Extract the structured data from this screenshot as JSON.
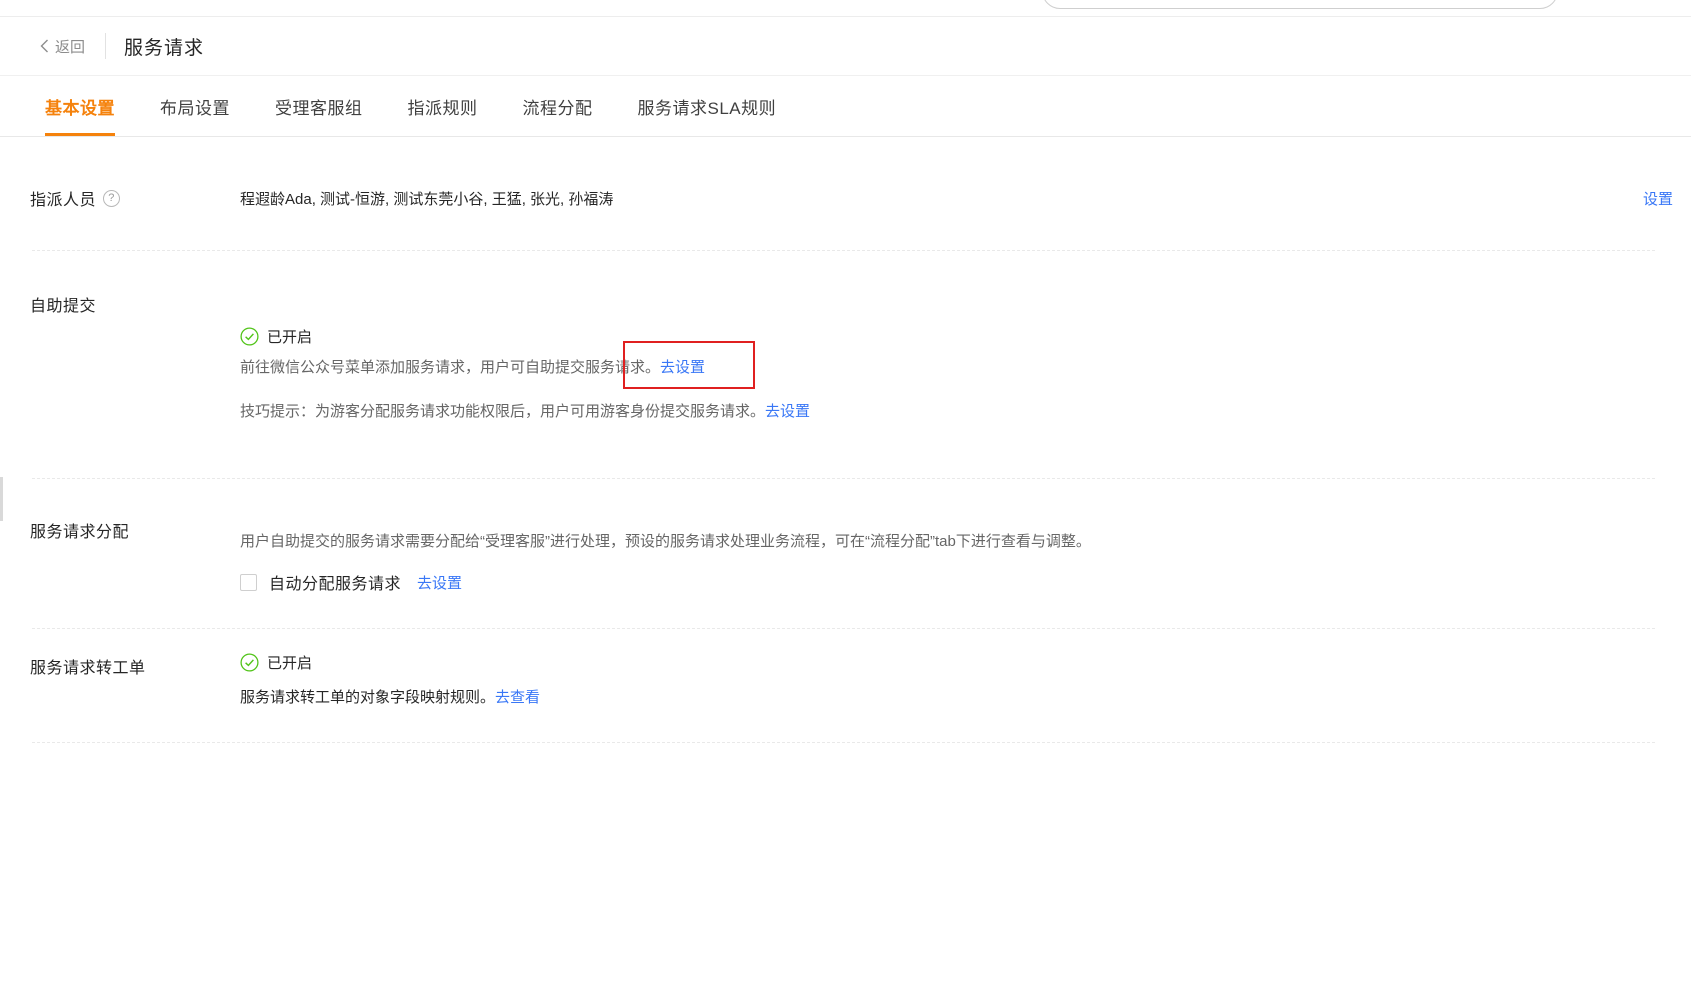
{
  "colors": {
    "accent_orange": "#f5820c",
    "link_blue": "#3977f6",
    "success_green": "#52c41a",
    "annotation_red": "#e02020"
  },
  "icons": {
    "back": "chevron-left-icon",
    "help_glyph": "?",
    "status_enabled": "check-circle-icon"
  },
  "header": {
    "back_label": "返回",
    "title": "服务请求"
  },
  "tabs": [
    {
      "label": "基本设置",
      "active": true
    },
    {
      "label": "布局设置",
      "active": false
    },
    {
      "label": "受理客服组",
      "active": false
    },
    {
      "label": "指派规则",
      "active": false
    },
    {
      "label": "流程分配",
      "active": false
    },
    {
      "label": "服务请求SLA规则",
      "active": false
    }
  ],
  "sections": {
    "assignee": {
      "label": "指派人员",
      "value": "程遐龄Ada, 测试-恒游, 测试东莞小谷, 王猛, 张光, 孙福涛",
      "action": "设置"
    },
    "self_service": {
      "label": "自助提交",
      "status": "已开启",
      "desc": "前往微信公众号菜单添加服务请求，用户可自助提交服务请求。",
      "desc_action": "去设置",
      "tip": "技巧提示：为游客分配服务请求功能权限后，用户可用游客身份提交服务请求。",
      "tip_action": "去设置"
    },
    "distribution": {
      "label": "服务请求分配",
      "desc": "用户自助提交的服务请求需要分配给“受理客服”进行处理，预设的服务请求处理业务流程，可在“流程分配”tab下进行查看与调整。",
      "checkbox_label": "自动分配服务请求",
      "checkbox_checked": false,
      "action": "去设置"
    },
    "to_ticket": {
      "label": "服务请求转工单",
      "status": "已开启",
      "desc": "服务请求转工单的对象字段映射规则。",
      "action": "去查看"
    }
  }
}
